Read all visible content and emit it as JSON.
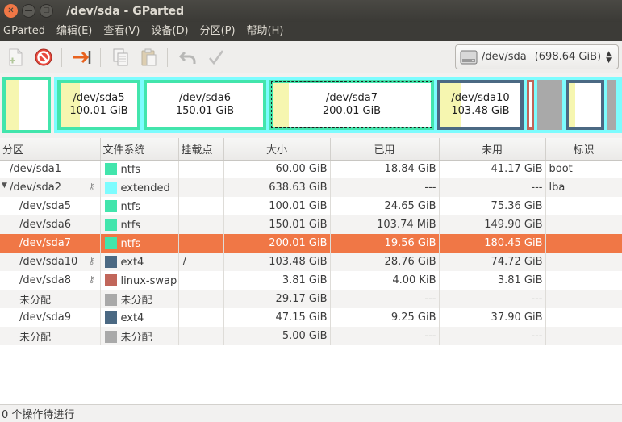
{
  "window": {
    "title": "/dev/sda - GParted"
  },
  "menu": [
    "GParted",
    "编辑(E)",
    "查看(V)",
    "设备(D)",
    "分区(P)",
    "帮助(H)"
  ],
  "toolbar": {
    "icons": [
      "new-partition-icon",
      "delete-icon",
      "resize-move-icon",
      "copy-icon",
      "paste-icon",
      "undo-icon",
      "apply-icon"
    ],
    "device": "/dev/sda",
    "device_size": "(698.64 GiB)"
  },
  "map": [
    {
      "name": "",
      "size": ""
    },
    {
      "name": "/dev/sda5",
      "size": "100.01 GiB"
    },
    {
      "name": "/dev/sda6",
      "size": "150.01 GiB"
    },
    {
      "name": "/dev/sda7",
      "size": "200.01 GiB"
    },
    {
      "name": "/dev/sda10",
      "size": "103.48 GiB"
    }
  ],
  "colors": {
    "ntfs": "#42e5ac",
    "extended": "#7dfcfe",
    "ext4": "#4b6983",
    "linux_swap": "#c1665a",
    "unallocated": "#a9a9a9",
    "selected": "#f07746"
  },
  "table": {
    "headers": [
      "分区",
      "文件系统",
      "挂载点",
      "大小",
      "已用",
      "未用",
      "标识"
    ],
    "rows": [
      {
        "partition": "/dev/sda1",
        "fs": "ntfs",
        "mount": "",
        "size": "60.00 GiB",
        "used": "18.84 GiB",
        "unused": "41.17 GiB",
        "flags": "boot"
      },
      {
        "partition": "/dev/sda2",
        "fs": "extended",
        "mount": "",
        "size": "638.63 GiB",
        "used": "---",
        "unused": "---",
        "flags": "lba"
      },
      {
        "partition": "/dev/sda5",
        "fs": "ntfs",
        "mount": "",
        "size": "100.01 GiB",
        "used": "24.65 GiB",
        "unused": "75.36 GiB",
        "flags": ""
      },
      {
        "partition": "/dev/sda6",
        "fs": "ntfs",
        "mount": "",
        "size": "150.01 GiB",
        "used": "103.74 MiB",
        "unused": "149.90 GiB",
        "flags": ""
      },
      {
        "partition": "/dev/sda7",
        "fs": "ntfs",
        "mount": "",
        "size": "200.01 GiB",
        "used": "19.56 GiB",
        "unused": "180.45 GiB",
        "flags": ""
      },
      {
        "partition": "/dev/sda10",
        "fs": "ext4",
        "mount": "/",
        "size": "103.48 GiB",
        "used": "28.76 GiB",
        "unused": "74.72 GiB",
        "flags": ""
      },
      {
        "partition": "/dev/sda8",
        "fs": "linux-swap",
        "mount": "",
        "size": "3.81 GiB",
        "used": "4.00 KiB",
        "unused": "3.81 GiB",
        "flags": ""
      },
      {
        "partition": "未分配",
        "fs": "未分配",
        "mount": "",
        "size": "29.17 GiB",
        "used": "---",
        "unused": "---",
        "flags": ""
      },
      {
        "partition": "/dev/sda9",
        "fs": "ext4",
        "mount": "",
        "size": "47.15 GiB",
        "used": "9.25 GiB",
        "unused": "37.90 GiB",
        "flags": ""
      },
      {
        "partition": "未分配",
        "fs": "未分配",
        "mount": "",
        "size": "5.00 GiB",
        "used": "---",
        "unused": "---",
        "flags": ""
      }
    ]
  },
  "status": "0 个操作待进行"
}
